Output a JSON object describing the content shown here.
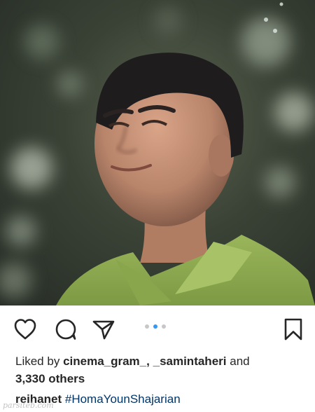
{
  "post": {
    "photo_alt": "portrait photo",
    "liked_by_prefix": "Liked by",
    "liked_user_1": "cinema_gram_",
    "separator": ",",
    "liked_user_2": "_samintaheri",
    "and_word": "and",
    "others_count": "3,330 others",
    "caption_user": "reihanet",
    "caption_hashtag": "#HomaYounShajarian",
    "watermark": "parsiteb.com"
  },
  "carousel": {
    "count": 3,
    "active_index": 1
  },
  "icons": {
    "like": "heart-icon",
    "comment": "comment-bubble-icon",
    "share": "paper-plane-icon",
    "save": "bookmark-icon"
  },
  "colors": {
    "active_dot": "#3897f0",
    "hashtag": "#003569",
    "text": "#262626"
  }
}
